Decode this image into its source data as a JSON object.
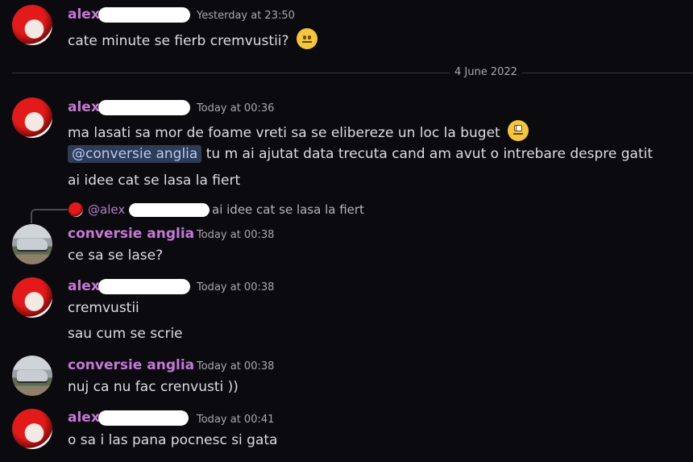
{
  "messages": [
    {
      "author": "alex",
      "time": "Yesterday at 23:50",
      "lines": [
        "cate minute se fierb cremvustii?"
      ],
      "emoji": "grimacing-face"
    },
    {
      "author": "alex",
      "time": "Today at 00:36",
      "lines": [
        "ma lasati sa mor de foame vreti sa se elibereze un loc la buget",
        "tu m ai ajutat data trecuta cand am avut o intrebare despre gatit",
        "ai idee cat se lasa la fiert"
      ],
      "mention": "@conversie anglia",
      "emoji": "eye-roll-face"
    },
    {
      "author": "conversie anglia",
      "time": "Today at 00:38",
      "lines": [
        "ce sa se lase?"
      ]
    },
    {
      "author": "alex",
      "time": "Today at 00:38",
      "lines": [
        "cremvustii",
        "sau cum se scrie"
      ]
    },
    {
      "author": "conversie anglia",
      "time": "Today at 00:38",
      "lines": [
        "nuj ca nu fac crenvusti ))"
      ]
    },
    {
      "author": "alex",
      "time": "Today at 00:41",
      "lines": [
        "o sa i las pana pocnesc si gata"
      ]
    }
  ],
  "date_divider": "4 June 2022",
  "reply": {
    "author": "@alex",
    "text": "ai idee cat se lasa la fiert"
  },
  "colors": {
    "background": "#0b0a0f",
    "author": "#c578d6",
    "mention_bg": "#2e3c56",
    "mention_fg": "#b6c9f7"
  }
}
